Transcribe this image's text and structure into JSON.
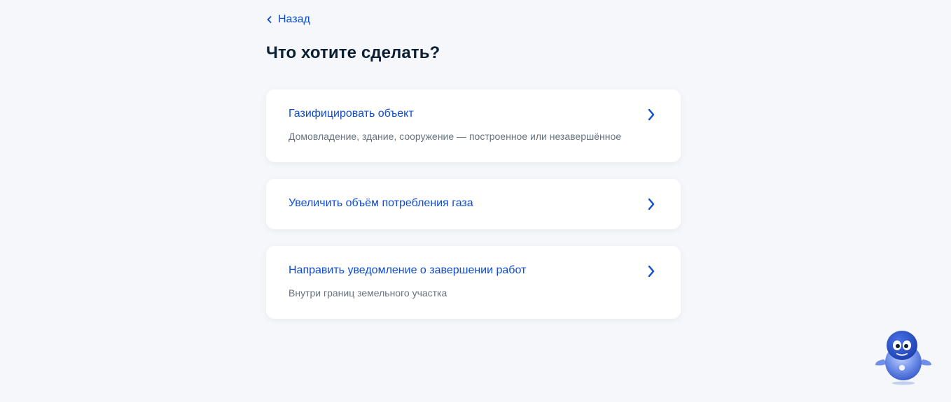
{
  "nav": {
    "back_label": "Назад"
  },
  "page": {
    "title": "Что хотите сделать?"
  },
  "options": [
    {
      "title": "Газифицировать объект",
      "description": "Домовладение, здание, сооружение — построенное или незавершённое"
    },
    {
      "title": "Увеличить объём потребления газа"
    },
    {
      "title": "Направить уведомление о завершении работ",
      "description": "Внутри границ земельного участка"
    }
  ],
  "icons": {
    "back": "chevron-left-icon",
    "option": "chevron-right-icon",
    "assistant": "robot-assistant-icon"
  },
  "colors": {
    "accent": "#0d4cd3",
    "title": "#0b1f33",
    "muted": "#66727f",
    "background": "#f5f7fa",
    "card": "#ffffff"
  }
}
